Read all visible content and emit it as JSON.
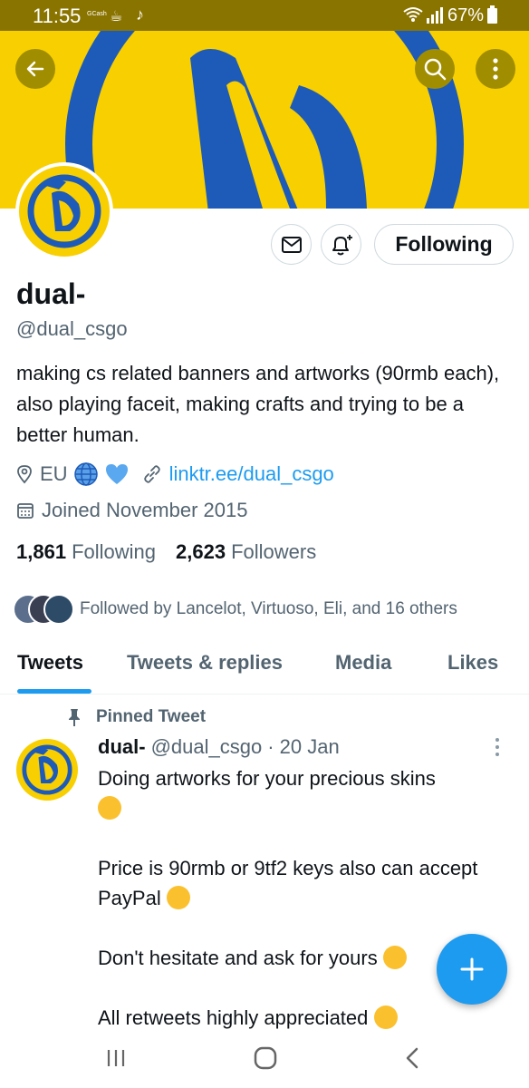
{
  "status_bar": {
    "time": "11:55",
    "gcash_label": "GCash",
    "battery": "67%"
  },
  "profile": {
    "display_name": "dual-",
    "handle": "@dual_csgo",
    "bio": "making cs related banners and artworks (90rmb each), also playing faceit, making crafts and trying to be a better human.",
    "location": "EU",
    "link": "linktr.ee/dual_csgo",
    "joined": "Joined November 2015",
    "following_count": "1,861",
    "following_label": "Following",
    "followers_count": "2,623",
    "followers_label": "Followers",
    "followed_by": "Followed by Lancelot, Virtuoso, Eli, and 16 others",
    "follow_button_label": "Following"
  },
  "tabs": [
    {
      "label": "Tweets",
      "active": true
    },
    {
      "label": "Tweets & replies",
      "active": false
    },
    {
      "label": "Media",
      "active": false
    },
    {
      "label": "Likes",
      "active": false
    }
  ],
  "pinned_tweet": {
    "pinned_label": "Pinned Tweet",
    "author_name": "dual-",
    "author_handle": "@dual_csgo",
    "date": "· 20 Jan",
    "lines": [
      "Doing artworks for your precious skins",
      "Price is 90rmb or 9tf2 keys also can accept PayPal",
      "Don't hesitate and ask for yours",
      "All retweets highly appreciated"
    ]
  },
  "colors": {
    "banner_yellow": "#f8cf00",
    "banner_blue": "#1e5bb8",
    "twitter_blue": "#1d9bf0",
    "status_bar": "#8a7400"
  },
  "icons": [
    "back-arrow-icon",
    "search-icon",
    "more-vertical-icon",
    "mail-icon",
    "bell-plus-icon",
    "location-pin-icon",
    "globe-icon",
    "blue-heart-icon",
    "link-icon",
    "calendar-icon",
    "pin-icon",
    "plus-icon",
    "recents-icon",
    "home-icon",
    "nav-back-icon"
  ]
}
